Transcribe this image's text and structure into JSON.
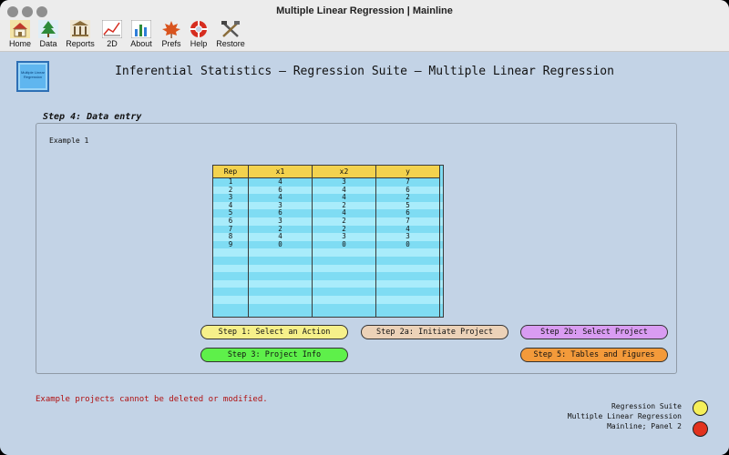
{
  "window": {
    "title": "Multiple Linear Regression | Mainline"
  },
  "toolbar": [
    {
      "label": "Home",
      "icon": "home-icon"
    },
    {
      "label": "Data",
      "icon": "tree-icon"
    },
    {
      "label": "Reports",
      "icon": "columns-icon"
    },
    {
      "label": "2D",
      "icon": "line-chart-icon"
    },
    {
      "label": "About",
      "icon": "bar-chart-icon"
    },
    {
      "label": "Prefs",
      "icon": "maple-leaf-icon"
    },
    {
      "label": "Help",
      "icon": "help-buoy-icon"
    },
    {
      "label": "Restore",
      "icon": "tools-icon"
    }
  ],
  "logo": {
    "text": "Multiple Linear Regression"
  },
  "header": {
    "title": "Inferential Statistics — Regression Suite — Multiple Linear Regression"
  },
  "step": {
    "label": "Step 4: Data entry"
  },
  "panel": {
    "example": "Example 1"
  },
  "table": {
    "columns": [
      "Rep",
      "x1",
      "x2",
      "y"
    ],
    "rows": [
      [
        "1",
        "4",
        "3",
        "7"
      ],
      [
        "2",
        "6",
        "4",
        "6"
      ],
      [
        "3",
        "4",
        "4",
        "2"
      ],
      [
        "4",
        "3",
        "2",
        "5"
      ],
      [
        "5",
        "6",
        "4",
        "6"
      ],
      [
        "6",
        "3",
        "2",
        "7"
      ],
      [
        "7",
        "2",
        "2",
        "4"
      ],
      [
        "8",
        "4",
        "3",
        "3"
      ],
      [
        "9",
        "0",
        "0",
        "0"
      ]
    ]
  },
  "buttons": {
    "step1": "Step 1: Select an Action",
    "step2a": "Step 2a: Initiate Project",
    "step2b": "Step 2b: Select Project",
    "step3": "Step 3: Project Info",
    "step5": "Step 5: Tables and Figures"
  },
  "colors": {
    "step1": "#f6f08a",
    "step2a": "#ecd2b8",
    "step2b": "#d99cf2",
    "step3": "#5ef04a",
    "step5": "#f39a3a",
    "yellow_dot": "#f5ef5a",
    "red_dot": "#e2321e"
  },
  "warning": "Example projects cannot be deleted or modified.",
  "status": {
    "line1": "Regression Suite",
    "line2": "Multiple Linear Regression",
    "line3": "Mainline; Panel 2"
  }
}
